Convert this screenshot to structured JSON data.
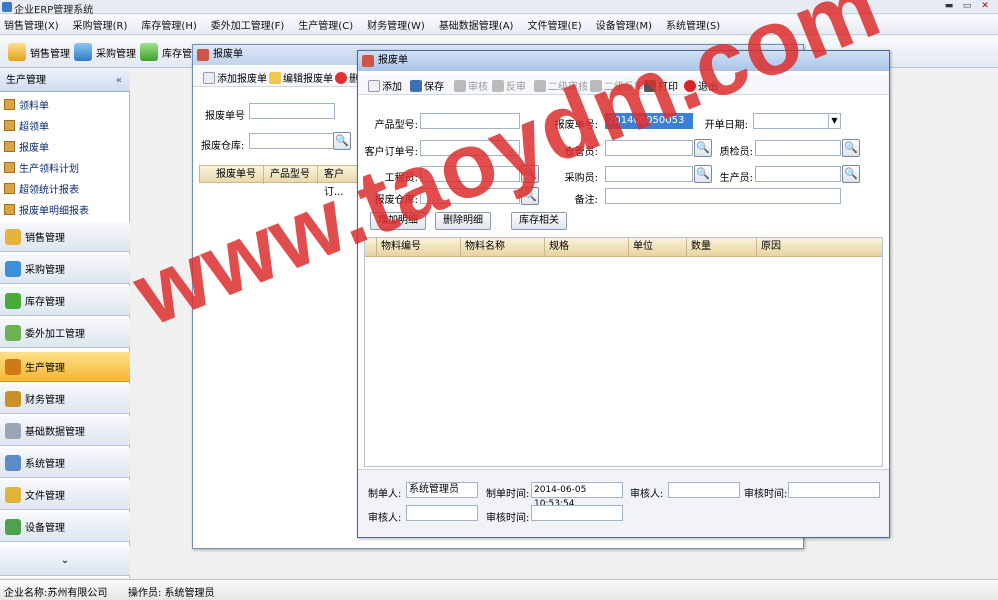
{
  "app": {
    "title": "企业ERP管理系统"
  },
  "menu": [
    "销售管理(X)",
    "采购管理(R)",
    "库存管理(H)",
    "委外加工管理(F)",
    "生产管理(C)",
    "财务管理(W)",
    "基础数据管理(A)",
    "文件管理(E)",
    "设备管理(M)",
    "系统管理(S)"
  ],
  "toolbar": {
    "sales": "销售管理",
    "purchase": "采购管理",
    "stock": "库存管"
  },
  "sidebar": {
    "header": "生产管理",
    "collapse": "«",
    "items": [
      "领料单",
      "超领单",
      "报废单",
      "生产领料计划",
      "超领统计报表",
      "报废单明细报表"
    ],
    "groups": [
      "销售管理",
      "采购管理",
      "库存管理",
      "委外加工管理",
      "生产管理",
      "财务管理",
      "基础数据管理",
      "系统管理",
      "文件管理",
      "设备管理"
    ],
    "active_group": "生产管理",
    "more": "⌄"
  },
  "bg_window": {
    "title": "报废单",
    "toolbar": {
      "add": "添加报废单",
      "edit": "编辑报废单",
      "delete": "删"
    },
    "fields": {
      "number_label": "报废单号",
      "warehouse_label": "报废仓库:"
    },
    "columns": [
      "报废单号",
      "产品型号",
      "客户订..."
    ]
  },
  "dialog": {
    "title": "报废单",
    "toolbar": {
      "add": "添加",
      "save": "保存",
      "audit": "审核",
      "unaudit": "反审",
      "audit2": "二级审核",
      "unaudit2": "二级反审",
      "print": "打印",
      "exit": "退出"
    },
    "labels": {
      "product_model": "产品型号:",
      "scrap_no": "报废单号:",
      "open_date": "开单日期:",
      "customer_order": "客户订单号:",
      "keeper": "仓管员:",
      "inspector": "质检员:",
      "engineer": "工程员:",
      "buyer": "采购员:",
      "producer": "生产员:",
      "warehouse": "报废仓库:",
      "remark": "备注:"
    },
    "values": {
      "scrap_no": "201406050053"
    },
    "buttons": {
      "add_detail": "增加明细",
      "del_detail": "删除明细",
      "stock_related": "库存相关"
    },
    "columns": [
      "物料编号",
      "物料名称",
      "规格",
      "单位",
      "数量",
      "原因"
    ],
    "footer": {
      "maker_label": "制单人:",
      "maker": "系统管理员",
      "make_time_label": "制单时间:",
      "make_time": "2014-06-05 10:53:54",
      "auditor_label": "审核人:",
      "audit_time_label": "审核时间:",
      "auditor2_label": "审核人:",
      "audit_time2_label": "审核时间:"
    }
  },
  "status": {
    "company": "企业名称:苏州有限公司",
    "operator": "操作员: 系统管理员"
  },
  "watermark": "www.taoydm.com"
}
